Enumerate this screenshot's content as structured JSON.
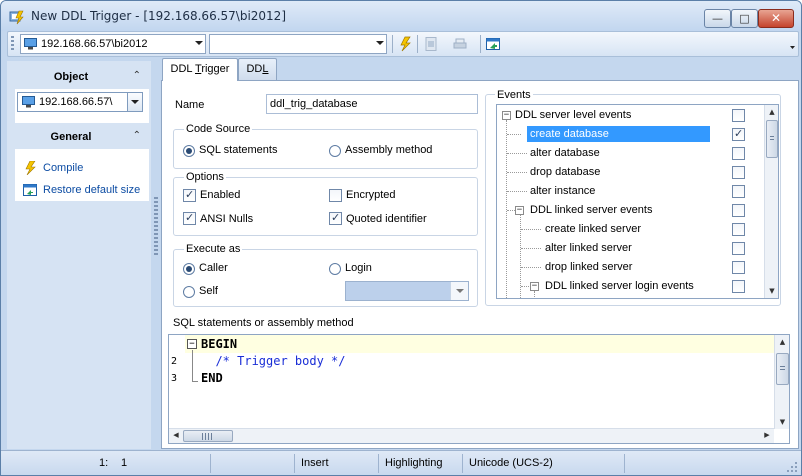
{
  "window": {
    "title": "New DDL Trigger - [192.168.66.57\\bi2012]",
    "minimize_glyph": "—",
    "maximize_glyph": "□",
    "close_glyph": "✕"
  },
  "toolbar": {
    "server_combo_value": "192.168.66.57\\bi2012",
    "database_combo_value": ""
  },
  "left_panel": {
    "object_header": "Object",
    "object_combo_value": "192.168.66.57\\",
    "general_header": "General",
    "collapse_glyph": "⌃",
    "compile_label": "Compile",
    "restore_label": "Restore default size"
  },
  "tabs": [
    {
      "label_prefix": "DDL ",
      "label_underline": "T",
      "label_suffix": "rigger"
    },
    {
      "label_prefix": "DD",
      "label_underline": "L",
      "label_suffix": ""
    }
  ],
  "form": {
    "name_label": "Name",
    "name_value": "ddl_trig_database",
    "code_source": {
      "title": "Code Source",
      "sql_statements": "SQL statements",
      "assembly_method": "Assembly method"
    },
    "options": {
      "title": "Options",
      "enabled": "Enabled",
      "encrypted": "Encrypted",
      "ansi_nulls": "ANSI Nulls",
      "quoted_identifier": "Quoted identifier"
    },
    "execute_as": {
      "title": "Execute as",
      "caller": "Caller",
      "login": "Login",
      "self": "Self"
    }
  },
  "events": {
    "title": "Events",
    "items": [
      {
        "label": "DDL server level events",
        "expander": "−",
        "checked": false,
        "selected": false
      },
      {
        "label": "create database",
        "checked": true,
        "selected": true
      },
      {
        "label": "alter database",
        "checked": false,
        "selected": false
      },
      {
        "label": "drop database",
        "checked": false,
        "selected": false
      },
      {
        "label": "alter instance",
        "checked": false,
        "selected": false
      },
      {
        "label": "DDL linked server events",
        "expander": "−",
        "checked": false,
        "selected": false
      },
      {
        "label": "create linked server",
        "checked": false,
        "selected": false
      },
      {
        "label": "alter linked server",
        "checked": false,
        "selected": false
      },
      {
        "label": "drop linked server",
        "checked": false,
        "selected": false
      },
      {
        "label": "DDL linked server login events",
        "expander": "−",
        "checked": false,
        "selected": false
      }
    ]
  },
  "editor": {
    "label": "SQL statements or assembly method",
    "fold_glyph": "−",
    "lines": [
      {
        "number": "",
        "text": "BEGIN",
        "kind": "keyword"
      },
      {
        "number": "2",
        "text": "  /* Trigger body */",
        "kind": "comment"
      },
      {
        "number": "3",
        "text": "END",
        "kind": "keyword"
      }
    ]
  },
  "scrollbar": {
    "up": "▲",
    "down": "▼",
    "left": "◀",
    "right": "▶"
  },
  "statusbar": {
    "position_line": "1:",
    "position_col": "1",
    "mode": "Insert",
    "highlighting": "Highlighting",
    "encoding": "Unicode (UCS-2)"
  }
}
